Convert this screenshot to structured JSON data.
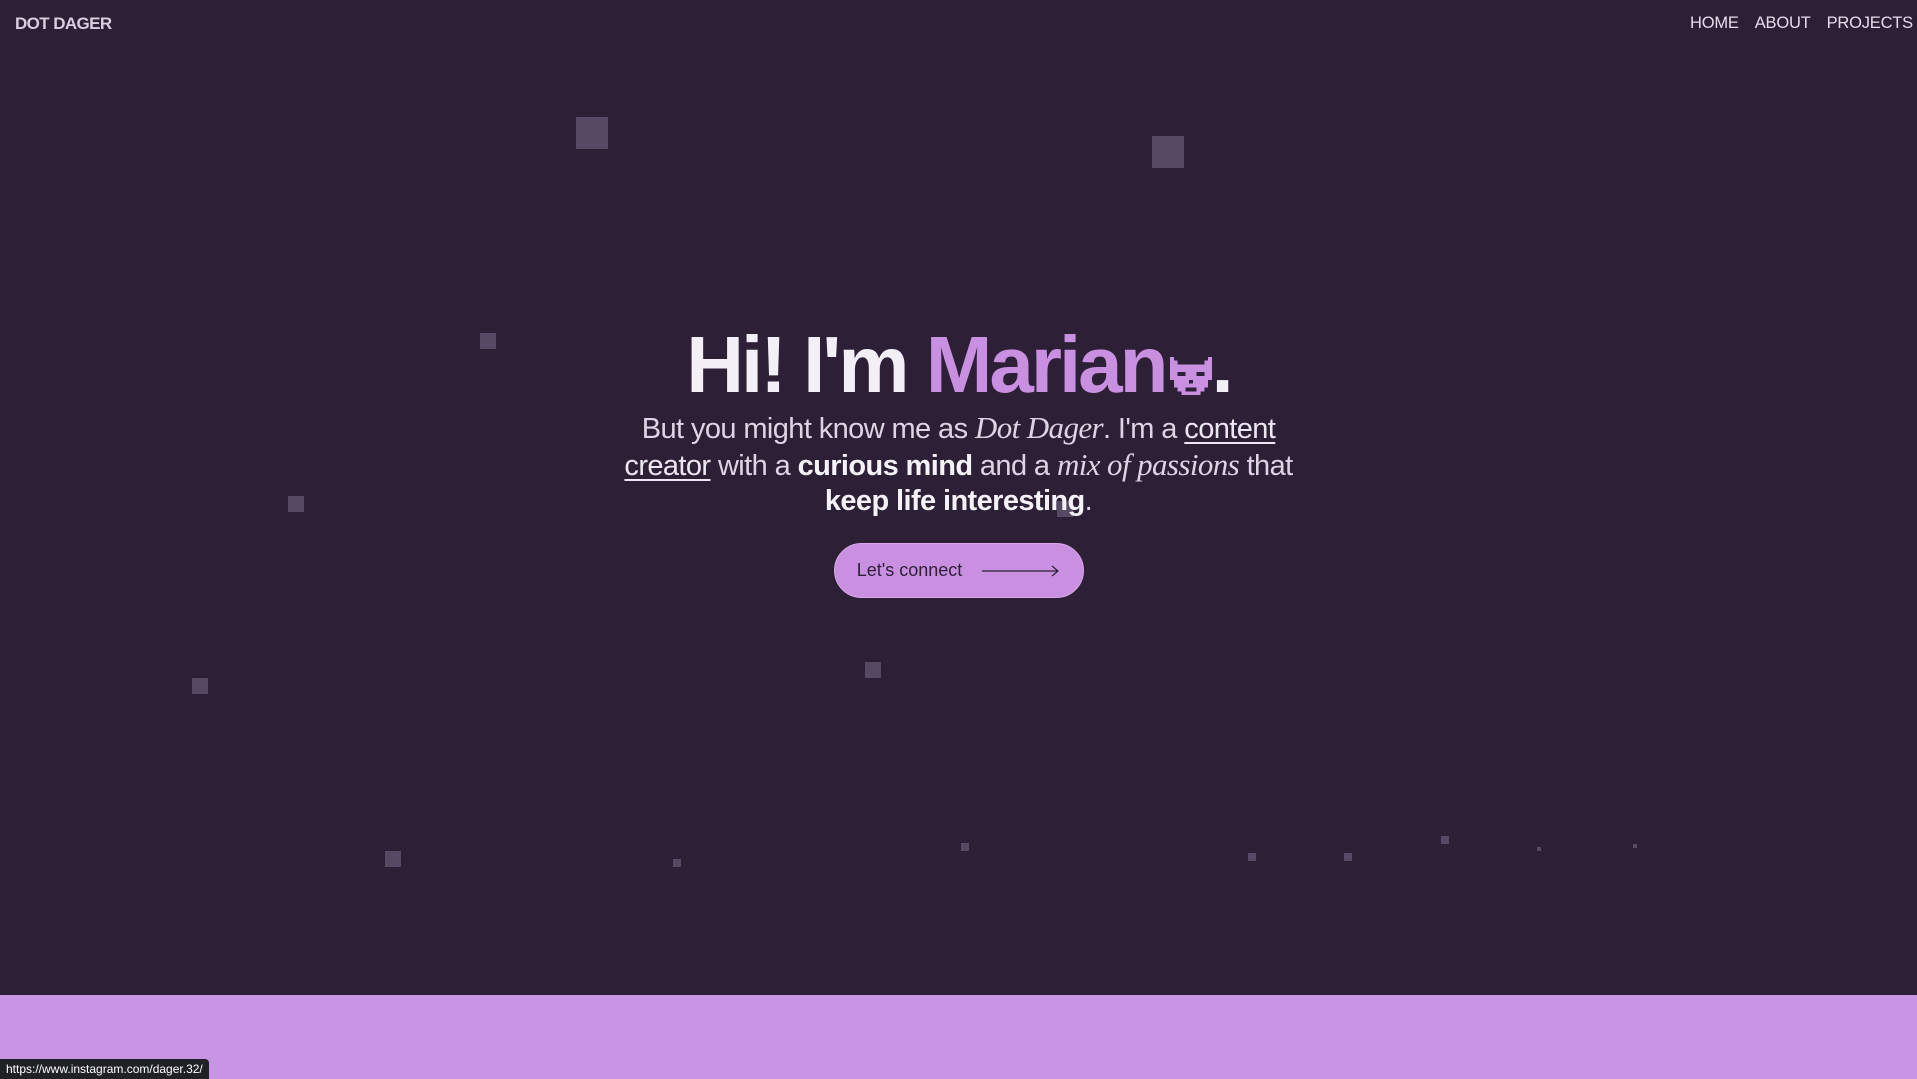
{
  "header": {
    "brand": "DOT DAGER",
    "nav": [
      {
        "label": "HOME"
      },
      {
        "label": "ABOUT"
      },
      {
        "label": "PROJECTS"
      }
    ]
  },
  "hero": {
    "greeting": "Hi! I'm ",
    "name": "Marian",
    "period": ".",
    "intro": {
      "p1": "But you might know me as ",
      "alias": "Dot Dager",
      "p2": ". I'm a ",
      "role": "content creator",
      "p3": " with a ",
      "trait": "curious mind",
      "p4": " and a ",
      "mix": "mix of passions",
      "p5": " that ",
      "tagline": "keep life interesting",
      "p6": "."
    },
    "cta_label": "Let's connect"
  },
  "status_bar": {
    "url": "https://www.instagram.com/dager.32/"
  },
  "colors": {
    "background": "#2d1f36",
    "accent": "#c98fe0",
    "decor_squares": "#554963",
    "footer_band": "#c895e4"
  },
  "icons": [
    "pixel-cat-icon",
    "arrow-right-icon"
  ]
}
